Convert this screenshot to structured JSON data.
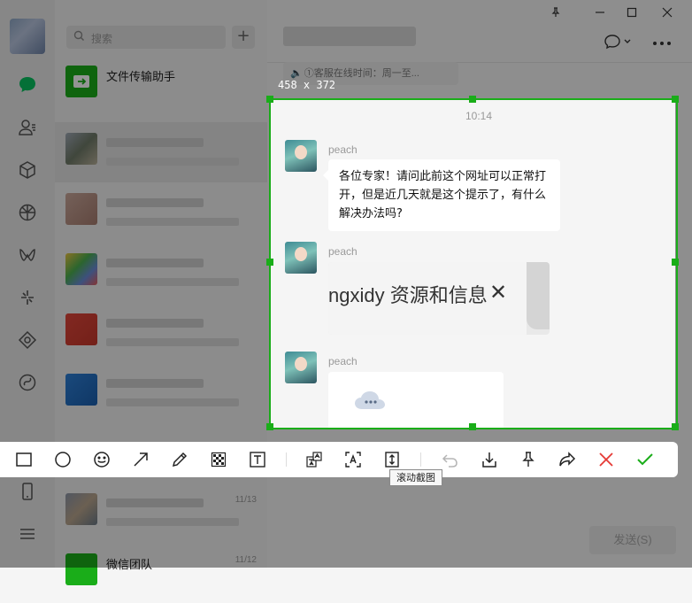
{
  "search": {
    "placeholder": "搜索"
  },
  "chat_list": [
    {
      "name": "文件传输助手"
    },
    {
      "time": "11/13"
    },
    {
      "name": "微信团队",
      "time": "11/12"
    }
  ],
  "chat": {
    "notice": "①客服在线时间：周一至..."
  },
  "capture": {
    "size_label": "458 x 372",
    "time": "10:14",
    "messages": [
      {
        "sender": "peach",
        "text": "各位专家！请问此前这个网址可以正常打开，但是近几天就是这个提示了，有什么解决办法吗?"
      },
      {
        "sender": "peach",
        "image_text": "ngxidy 资源和信息"
      },
      {
        "sender": "peach"
      }
    ]
  },
  "input": {
    "send_label": "发送(S)"
  },
  "toolbar": {
    "tooltip": "滚动截图",
    "tools": [
      "rectangle-icon",
      "ellipse-icon",
      "emoji-icon",
      "arrow-icon",
      "pen-icon",
      "mosaic-icon",
      "text-icon",
      "translate-icon",
      "ocr-icon",
      "scroll-capture-icon",
      "undo-icon",
      "save-icon",
      "pin-icon",
      "share-icon",
      "cancel-icon",
      "confirm-icon"
    ]
  },
  "colors": {
    "accent": "#1aad19",
    "cancel": "#e53935",
    "dim": "rgba(0,0,0,0.42)"
  }
}
